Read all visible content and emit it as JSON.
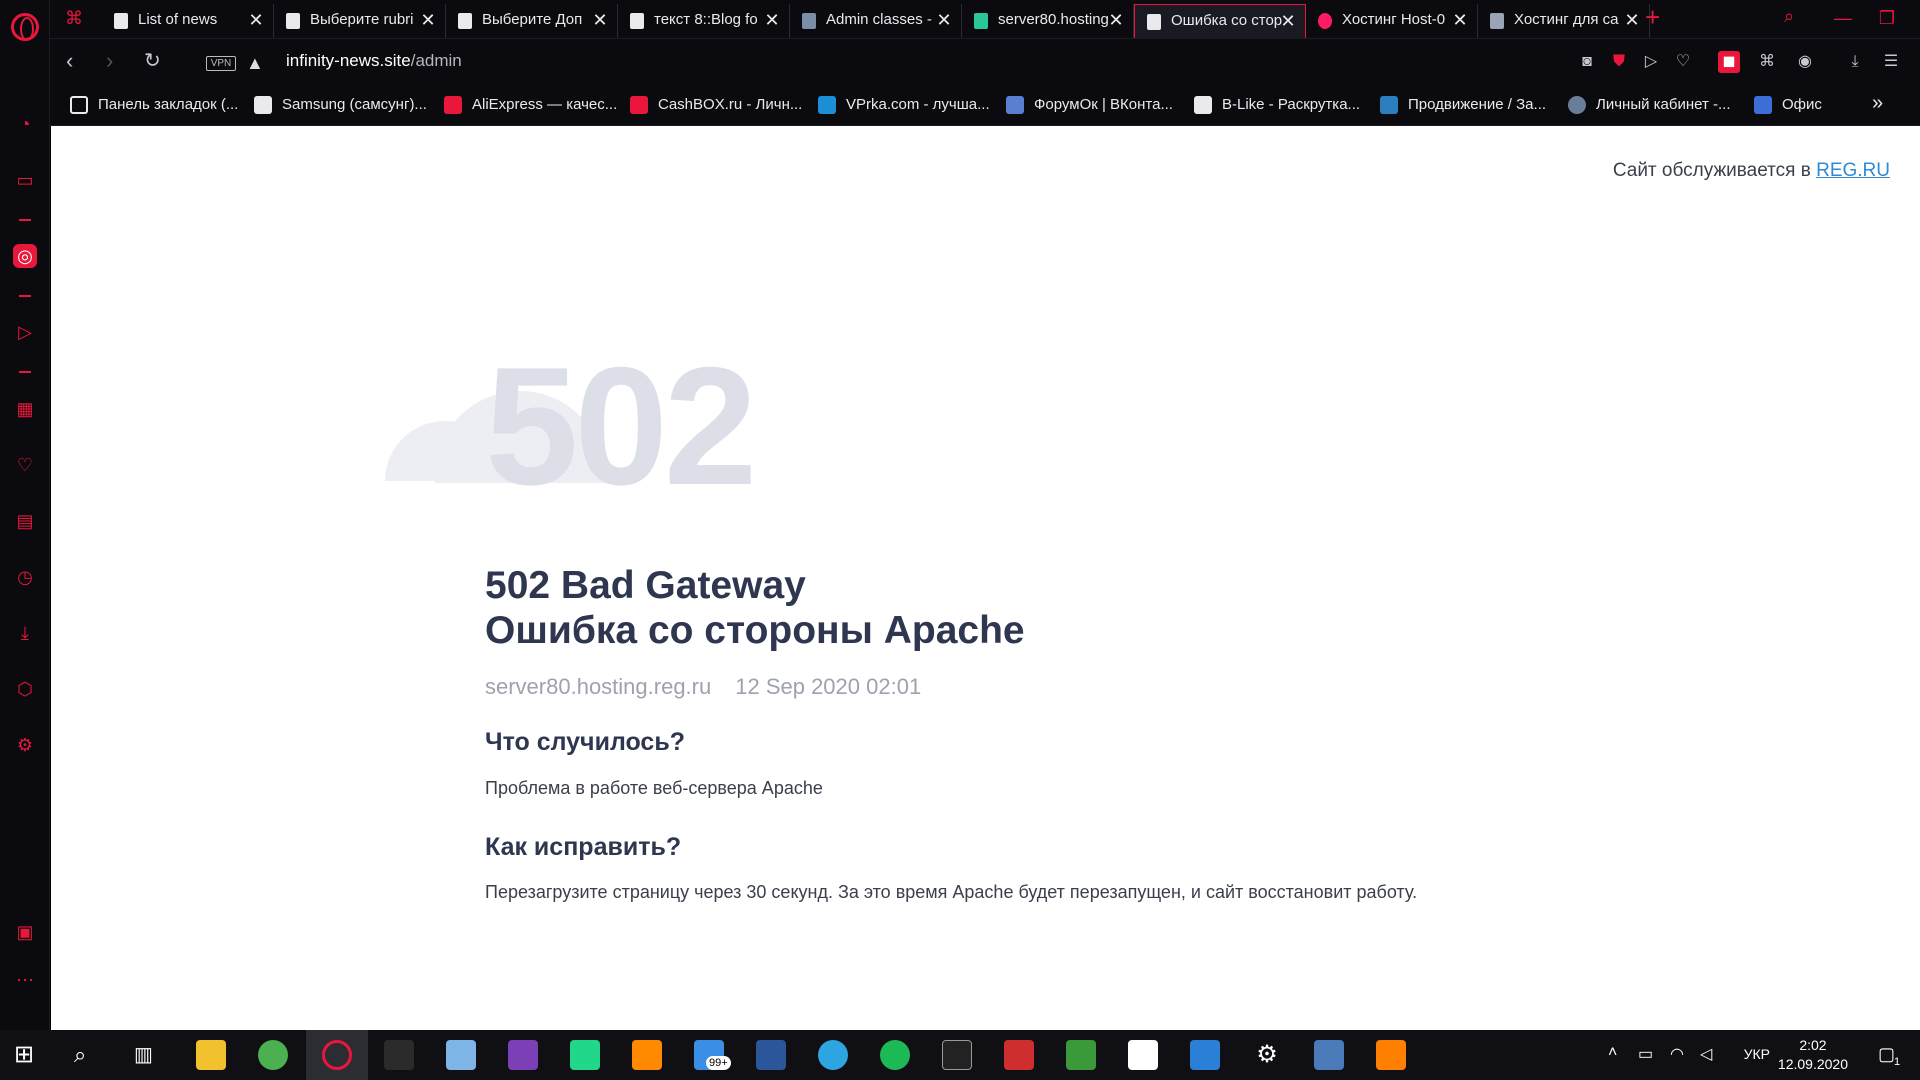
{
  "browser": {
    "tabs": [
      {
        "label": "List of news",
        "active": false
      },
      {
        "label": "Выберите rubri",
        "active": false
      },
      {
        "label": "Выберите Доп",
        "active": false
      },
      {
        "label": "текст 8::Blog fo",
        "active": false
      },
      {
        "label": "Admin classes -",
        "active": false
      },
      {
        "label": "server80.hosting",
        "active": false
      },
      {
        "label": "Ошибка со стор",
        "active": true
      },
      {
        "label": "Хостинг Host-0",
        "active": false
      },
      {
        "label": "Хостинг для са",
        "active": false
      }
    ],
    "address": {
      "vpn_label": "VPN",
      "host": "infinity-news.site",
      "path": "/admin"
    },
    "bookmarks": [
      {
        "label": "Панель закладок (...",
        "icon": "folder-icon",
        "color": "#e9e9ee"
      },
      {
        "label": "Samsung (самсунг)...",
        "icon": "cart-icon",
        "color": "#e9e9ee"
      },
      {
        "label": "AliExpress — качес...",
        "icon": "aliexpress-icon",
        "color": "#e8173b"
      },
      {
        "label": "CashBOX.ru - Личн...",
        "icon": "play-icon",
        "color": "#e8173b"
      },
      {
        "label": "VPrka.com - лучша...",
        "icon": "vprka-icon",
        "color": "#1a8fd6"
      },
      {
        "label": "ФорумОк | ВКонта...",
        "icon": "forum-icon",
        "color": "#5a7fd0"
      },
      {
        "label": "B-Like - Раскрутка...",
        "icon": "page-icon",
        "color": "#e9e9ee"
      },
      {
        "label": "Продвижение / За...",
        "icon": "triangle-icon",
        "color": "#2c7fbf"
      },
      {
        "label": "Личный кабинет -...",
        "icon": "pacman-icon",
        "color": "#6a7d99"
      },
      {
        "label": "Офис",
        "icon": "pr-icon",
        "color": "#3b6fd6"
      }
    ]
  },
  "page": {
    "hosting_note": "Сайт обслуживается в",
    "hosting_link": "REG.RU",
    "error_code": "502",
    "title_line1": "502 Bad Gateway",
    "title_line2": "Ошибка со стороны Apache",
    "server": "server80.hosting.reg.ru",
    "timestamp": "12 Sep 2020 02:01",
    "what_happened_heading": "Что случилось?",
    "what_happened_text": "Проблема в работе веб-сервера Apache",
    "how_to_fix_heading": "Как исправить?",
    "how_to_fix_text": "Перезагрузите страницу через 30 секунд. За это время Apache будет перезапущен, и сайт восстановит работу."
  },
  "taskbar": {
    "mail_badge": "99+",
    "language": "УКР",
    "time": "2:02",
    "date": "12.09.2020",
    "notification_count": "1"
  }
}
